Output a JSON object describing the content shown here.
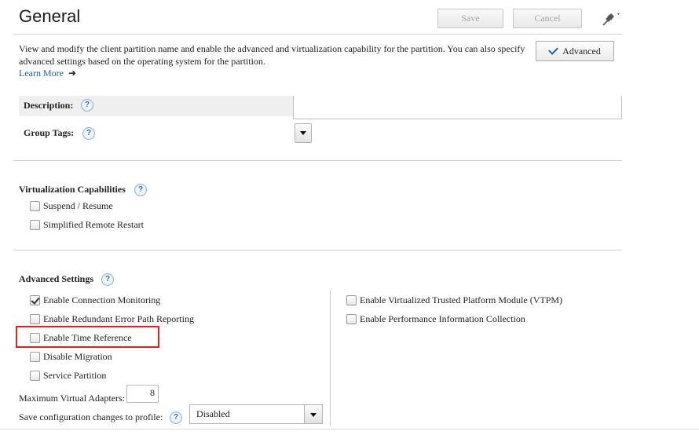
{
  "header": {
    "title": "General",
    "save_label": "Save",
    "cancel_label": "Cancel",
    "pin_icon": "pin-icon"
  },
  "intro": {
    "description": "View and modify the client partition name and enable the advanced and virtualization capability for the partition. You can also specify advanced settings based on the operating system for the partition.",
    "learn_more": "Learn More",
    "advanced_button": "Advanced"
  },
  "fields": {
    "description_label": "Description:",
    "description_value": "",
    "group_tags_label": "Group Tags:"
  },
  "virtualization": {
    "heading": "Virtualization Capabilities",
    "options": [
      {
        "label": "Suspend / Resume",
        "checked": false
      },
      {
        "label": "Simplified Remote Restart",
        "checked": false
      }
    ]
  },
  "advanced": {
    "heading": "Advanced Settings",
    "left_options": [
      {
        "label": "Enable Connection Monitoring",
        "checked": true
      },
      {
        "label": "Enable Redundant Error Path Reporting",
        "checked": false
      },
      {
        "label": "Enable Time Reference",
        "checked": false,
        "highlighted": true
      },
      {
        "label": "Disable Migration",
        "checked": false
      },
      {
        "label": "Service Partition",
        "checked": false
      }
    ],
    "right_options": [
      {
        "label": "Enable Virtualized Trusted Platform Module (VTPM)",
        "checked": false
      },
      {
        "label": "Enable Performance Information Collection",
        "checked": false
      }
    ],
    "max_virtual_adapters_label": "Maximum Virtual Adapters:",
    "max_virtual_adapters_value": "8",
    "save_config_label": "Save configuration changes to profile:",
    "save_config_value": "Disabled"
  },
  "colors": {
    "highlight": "#e0221d",
    "link": "#1f5d99",
    "checkmark": "#1a66b2"
  }
}
